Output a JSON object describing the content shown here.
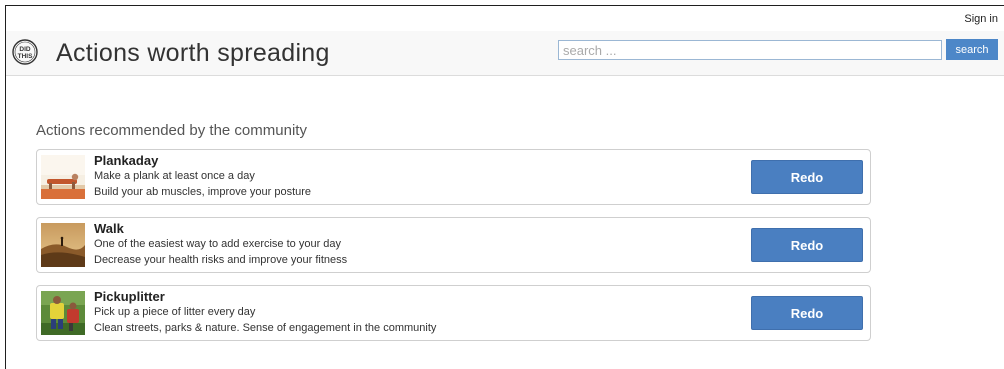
{
  "topbar": {
    "signin_label": "Sign in"
  },
  "header": {
    "logo_icon": "did-this-stamp-icon",
    "logo_text": [
      "DID",
      "THIS"
    ],
    "title": "Actions worth spreading",
    "search": {
      "placeholder": "search ...",
      "value": "",
      "button_label": "search"
    }
  },
  "colors": {
    "accent": "#4a7fc1",
    "search_button": "#4d87c8"
  },
  "section": {
    "title": "Actions recommended by the community"
  },
  "actions": [
    {
      "title": "Plankaday",
      "line1": "Make a plank at least once a day",
      "line2": "Build your ab muscles, improve your posture",
      "button_label": "Redo"
    },
    {
      "title": "Walk",
      "line1": "One of the easiest way to add exercise to your day",
      "line2": "Decrease your health risks and improve your fitness",
      "button_label": "Redo"
    },
    {
      "title": "Pickuplitter",
      "line1": "Pick up a piece of litter every day",
      "line2": "Clean streets, parks & nature. Sense of engagement in the community",
      "button_label": "Redo"
    }
  ]
}
